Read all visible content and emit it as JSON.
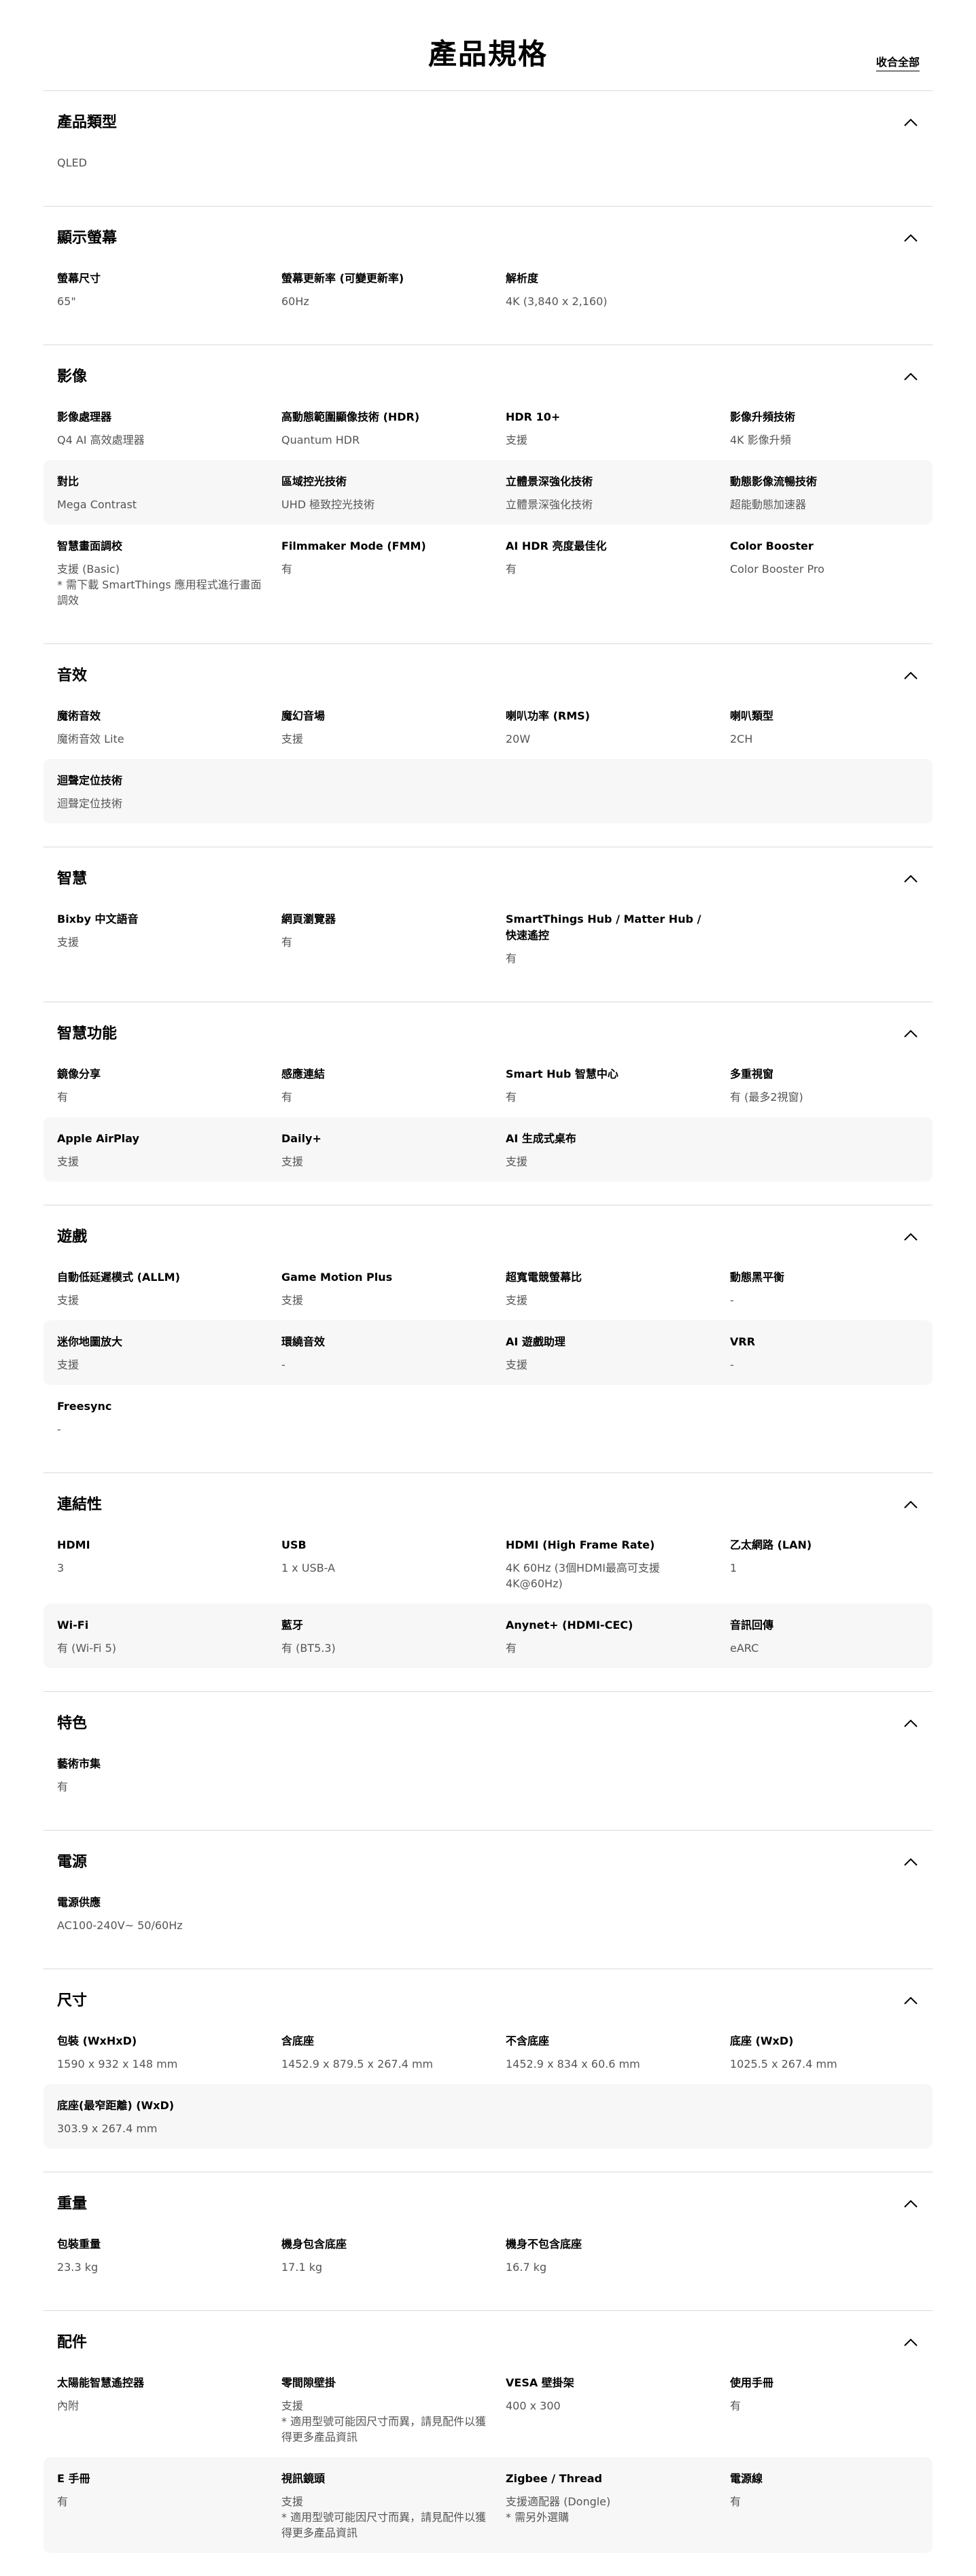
{
  "page": {
    "title": "產品規格",
    "collapse_all": "收合全部"
  },
  "sections": [
    {
      "title": "產品類型",
      "rows": [
        [
          {
            "label": "",
            "value": "QLED"
          }
        ]
      ]
    },
    {
      "title": "顯示螢幕",
      "rows": [
        [
          {
            "label": "螢幕尺寸",
            "value": "65\""
          },
          {
            "label": "螢幕更新率 (可變更新率)",
            "value": "60Hz"
          },
          {
            "label": "解析度",
            "value": "4K (3,840 x 2,160)"
          }
        ]
      ]
    },
    {
      "title": "影像",
      "rows": [
        [
          {
            "label": "影像處理器",
            "value": "Q4 AI 高效處理器"
          },
          {
            "label": "高動態範圍顯像技術 (HDR)",
            "value": "Quantum HDR"
          },
          {
            "label": "HDR 10+",
            "value": "支援"
          },
          {
            "label": "影像升頻技術",
            "value": "4K 影像升頻"
          }
        ],
        [
          {
            "label": "對比",
            "value": "Mega Contrast"
          },
          {
            "label": "區域控光技術",
            "value": "UHD 極致控光技術"
          },
          {
            "label": "立體景深強化技術",
            "value": "立體景深強化技術"
          },
          {
            "label": "動態影像流暢技術",
            "value": "超能動態加速器"
          }
        ],
        [
          {
            "label": "智慧畫面調校",
            "value": "支援 (Basic)\n* 需下載 SmartThings 應用程式進行畫面調效"
          },
          {
            "label": "Filmmaker Mode (FMM)",
            "value": "有"
          },
          {
            "label": "AI HDR 亮度最佳化",
            "value": "有"
          },
          {
            "label": "Color Booster",
            "value": "Color Booster Pro"
          }
        ]
      ]
    },
    {
      "title": "音效",
      "rows": [
        [
          {
            "label": "魔術音效",
            "value": "魔術音效 Lite"
          },
          {
            "label": "魔幻音場",
            "value": "支援"
          },
          {
            "label": "喇叭功率 (RMS)",
            "value": "20W"
          },
          {
            "label": "喇叭類型",
            "value": "2CH"
          }
        ],
        [
          {
            "label": "迴聲定位技術",
            "value": "迴聲定位技術"
          }
        ]
      ]
    },
    {
      "title": "智慧",
      "rows": [
        [
          {
            "label": "Bixby 中文語音",
            "value": "支援"
          },
          {
            "label": "網頁瀏覽器",
            "value": "有"
          },
          {
            "label": "SmartThings Hub / Matter Hub / 快速遙控",
            "value": "有"
          }
        ]
      ]
    },
    {
      "title": "智慧功能",
      "rows": [
        [
          {
            "label": "鏡像分享",
            "value": "有"
          },
          {
            "label": "感應連結",
            "value": "有"
          },
          {
            "label": "Smart Hub 智慧中心",
            "value": "有"
          },
          {
            "label": "多重視窗",
            "value": "有 (最多2視窗)"
          }
        ],
        [
          {
            "label": "Apple AirPlay",
            "value": "支援"
          },
          {
            "label": "Daily+",
            "value": "支援"
          },
          {
            "label": "AI 生成式桌布",
            "value": "支援"
          }
        ]
      ]
    },
    {
      "title": "遊戲",
      "rows": [
        [
          {
            "label": "自動低延遲模式 (ALLM)",
            "value": "支援"
          },
          {
            "label": "Game Motion Plus",
            "value": "支援"
          },
          {
            "label": "超寬電競螢幕比",
            "value": "支援"
          },
          {
            "label": "動態黑平衡",
            "value": "-"
          }
        ],
        [
          {
            "label": "迷你地圖放大",
            "value": "支援"
          },
          {
            "label": "環繞音效",
            "value": "-"
          },
          {
            "label": "AI 遊戲助理",
            "value": "支援"
          },
          {
            "label": "VRR",
            "value": "-"
          }
        ],
        [
          {
            "label": "Freesync",
            "value": "-"
          }
        ]
      ]
    },
    {
      "title": "連結性",
      "rows": [
        [
          {
            "label": "HDMI",
            "value": "3"
          },
          {
            "label": "USB",
            "value": "1 x USB-A"
          },
          {
            "label": "HDMI (High Frame Rate)",
            "value": "4K 60Hz (3個HDMI最高可支援4K@60Hz)"
          },
          {
            "label": "乙太網路 (LAN)",
            "value": "1"
          }
        ],
        [
          {
            "label": "Wi-Fi",
            "value": "有 (Wi-Fi 5)"
          },
          {
            "label": "藍牙",
            "value": "有 (BT5.3)"
          },
          {
            "label": "Anynet+ (HDMI-CEC)",
            "value": "有"
          },
          {
            "label": "音訊回傳",
            "value": "eARC"
          }
        ]
      ]
    },
    {
      "title": "特色",
      "rows": [
        [
          {
            "label": "藝術市集",
            "value": "有"
          }
        ]
      ]
    },
    {
      "title": "電源",
      "rows": [
        [
          {
            "label": "電源供應",
            "value": "AC100-240V~ 50/60Hz"
          }
        ]
      ]
    },
    {
      "title": "尺寸",
      "rows": [
        [
          {
            "label": "包裝 (WxHxD)",
            "value": "1590 x 932 x 148 mm"
          },
          {
            "label": "含底座",
            "value": "1452.9 x 879.5 x 267.4 mm"
          },
          {
            "label": "不含底座",
            "value": "1452.9 x 834 x 60.6 mm"
          },
          {
            "label": "底座 (WxD)",
            "value": "1025.5 x 267.4 mm"
          }
        ],
        [
          {
            "label": "底座(最窄距離) (WxD)",
            "value": "303.9 x 267.4 mm"
          }
        ]
      ]
    },
    {
      "title": "重量",
      "rows": [
        [
          {
            "label": "包裝重量",
            "value": "23.3 kg"
          },
          {
            "label": "機身包含底座",
            "value": "17.1 kg"
          },
          {
            "label": "機身不包含底座",
            "value": "16.7 kg"
          }
        ]
      ]
    },
    {
      "title": "配件",
      "rows": [
        [
          {
            "label": "太陽能智慧遙控器",
            "value": "內附"
          },
          {
            "label": "零間隙壁掛",
            "value": "支援\n* 適用型號可能因尺寸而異，請見配件以獲得更多產品資訊"
          },
          {
            "label": "VESA 壁掛架",
            "value": "400 x 300"
          },
          {
            "label": "使用手冊",
            "value": "有"
          }
        ],
        [
          {
            "label": "E 手冊",
            "value": "有"
          },
          {
            "label": "視訊鏡頭",
            "value": "支援\n* 適用型號可能因尺寸而異，請見配件以獲得更多產品資訊"
          },
          {
            "label": "Zigbee / Thread",
            "value": "支援適配器 (Dongle)\n* 需另外選購"
          },
          {
            "label": "電源線",
            "value": "有"
          }
        ]
      ]
    }
  ]
}
